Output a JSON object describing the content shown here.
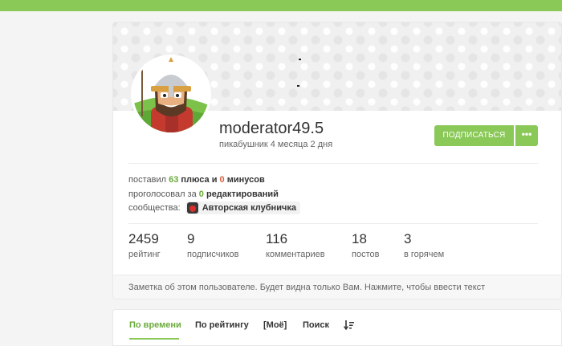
{
  "profile": {
    "username": "moderator49.5",
    "since": "пикабушник 4 месяца 2 дня",
    "subscribe_label": "ПОДПИСАТЬСЯ",
    "more_label": "•••",
    "avatar_icon": "knight-avatar-icon"
  },
  "info": {
    "voted_prefix": "поставил",
    "plus_count": "63",
    "plus_word": "плюса и",
    "minus_count": "0",
    "minus_word": "минусов",
    "edits_prefix": "проголосовал за",
    "edits_count": "0",
    "edits_word": "редактирований",
    "communities_label": "сообщества:",
    "community_name": "Авторская клубничка"
  },
  "stats": [
    {
      "value": "2459",
      "label": "рейтинг"
    },
    {
      "value": "9",
      "label": "подписчиков"
    },
    {
      "value": "116",
      "label": "комментариев"
    },
    {
      "value": "18",
      "label": "постов"
    },
    {
      "value": "3",
      "label": "в горячем"
    }
  ],
  "note": "Заметка об этом пользователе. Будет видна только Вам. Нажмите, чтобы ввести текст",
  "tabs": [
    {
      "label": "По времени",
      "active": true
    },
    {
      "label": "По рейтингу",
      "active": false
    },
    {
      "label": "[Моё]",
      "active": false
    },
    {
      "label": "Поиск",
      "active": false
    }
  ],
  "colors": {
    "accent": "#8ac858",
    "plus": "#6aaa3a",
    "minus": "#e06040"
  }
}
